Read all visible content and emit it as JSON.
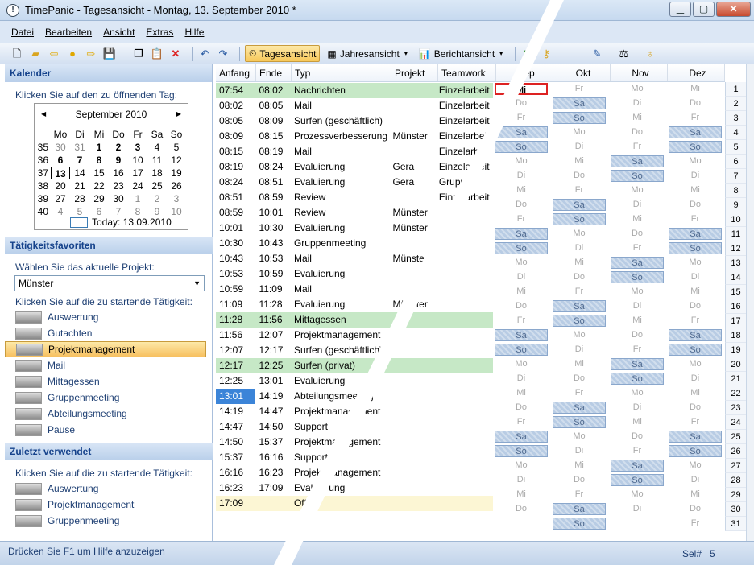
{
  "window": {
    "title": "TimePanic - Tagesansicht - Montag, 13. September 2010 *"
  },
  "menu": [
    "Datei",
    "Bearbeiten",
    "Ansicht",
    "Extras",
    "Hilfe"
  ],
  "views": [
    "Tagesansicht",
    "Jahresansicht",
    "Berichtansicht"
  ],
  "kalender": {
    "header": "Kalender",
    "hint": "Klicken Sie auf den zu öffnenden Tag:",
    "month": "September 2010",
    "weekdays": [
      "Mo",
      "Di",
      "Mi",
      "Do",
      "Fr",
      "Sa",
      "So"
    ],
    "today": "Today: 13.09.2010",
    "weeks": [
      [
        "35",
        "30",
        "31",
        "1",
        "2",
        "3",
        "4",
        "5"
      ],
      [
        "36",
        "6",
        "7",
        "8",
        "9",
        "10",
        "11",
        "12"
      ],
      [
        "37",
        "13",
        "14",
        "15",
        "16",
        "17",
        "18",
        "19"
      ],
      [
        "38",
        "20",
        "21",
        "22",
        "23",
        "24",
        "25",
        "26"
      ],
      [
        "39",
        "27",
        "28",
        "29",
        "30",
        "1",
        "2",
        "3"
      ],
      [
        "40",
        "4",
        "5",
        "6",
        "7",
        "8",
        "9",
        "10"
      ]
    ]
  },
  "favoriten": {
    "header": "Tätigkeitsfavoriten",
    "projectHint": "Wählen Sie das aktuelle Projekt:",
    "project": "Münster",
    "activityHint": "Klicken Sie auf die zu startende Tätigkeit:",
    "items": [
      "Auswertung",
      "Gutachten",
      "Projektmanagement",
      "Mail",
      "Mittagessen",
      "Gruppenmeeting",
      "Abteilungsmeeting",
      "Pause"
    ],
    "selected": "Projektmanagement"
  },
  "recent": {
    "header": "Zuletzt verwendet",
    "hint": "Klicken Sie auf die zu startende Tätigkeit:",
    "items": [
      "Auswertung",
      "Projektmanagement",
      "Gruppenmeeting"
    ]
  },
  "status": {
    "text": "Drücken Sie F1 um Hilfe anzuzeigen",
    "sel": "Sel#",
    "selCount": "5"
  },
  "columns": [
    "Anfang",
    "Ende",
    "Typ",
    "Projekt",
    "Teamwork",
    "Sep",
    "Okt",
    "Nov",
    "Dez"
  ],
  "entries": [
    [
      "07:54",
      "08:02",
      "Nachrichten",
      "",
      "Einzelarbeit"
    ],
    [
      "08:02",
      "08:05",
      "Mail",
      "",
      "Einzelarbeit"
    ],
    [
      "08:05",
      "08:09",
      "Surfen (geschäftlich)",
      "",
      "Einzelarbeit"
    ],
    [
      "08:09",
      "08:15",
      "Prozessverbesserung",
      "Münster",
      "Einzelarbeit"
    ],
    [
      "08:15",
      "08:19",
      "Mail",
      "",
      "Einzelarbeit"
    ],
    [
      "08:19",
      "08:24",
      "Evaluierung",
      "Gera",
      "Einzelarbeit"
    ],
    [
      "08:24",
      "08:51",
      "Evaluierung",
      "Gera",
      "Gruppe"
    ],
    [
      "08:51",
      "08:59",
      "Review",
      "",
      "Einzelarbeit"
    ],
    [
      "08:59",
      "10:01",
      "Review",
      "Münster",
      ""
    ],
    [
      "10:01",
      "10:30",
      "Evaluierung",
      "Münster",
      ""
    ],
    [
      "10:30",
      "10:43",
      "Gruppenmeeting",
      "",
      ""
    ],
    [
      "10:43",
      "10:53",
      "Mail",
      "Münster",
      ""
    ],
    [
      "10:53",
      "10:59",
      "Evaluierung",
      "",
      ""
    ],
    [
      "10:59",
      "11:09",
      "Mail",
      "",
      ""
    ],
    [
      "11:09",
      "11:28",
      "Evaluierung",
      "Münster",
      ""
    ],
    [
      "11:28",
      "11:56",
      "Mittagessen",
      "",
      ""
    ],
    [
      "11:56",
      "12:07",
      "Projektmanagement",
      "",
      ""
    ],
    [
      "12:07",
      "12:17",
      "Surfen (geschäftlich)",
      "",
      ""
    ],
    [
      "12:17",
      "12:25",
      "Surfen (privat)",
      "",
      ""
    ],
    [
      "12:25",
      "13:01",
      "Evaluierung",
      "",
      ""
    ],
    [
      "13:01",
      "14:19",
      "Abteilungsmeeting",
      "",
      ""
    ],
    [
      "14:19",
      "14:47",
      "Projektmanagement",
      "",
      ""
    ],
    [
      "14:47",
      "14:50",
      "Support",
      "",
      ""
    ],
    [
      "14:50",
      "15:37",
      "Projektmanagement",
      "",
      ""
    ],
    [
      "15:37",
      "16:16",
      "Support",
      "",
      ""
    ],
    [
      "16:16",
      "16:23",
      "Projektmanagement",
      "",
      ""
    ],
    [
      "16:23",
      "17:09",
      "Evaluierung",
      "",
      ""
    ],
    [
      "17:09",
      "",
      "Offen",
      "",
      ""
    ]
  ]
}
